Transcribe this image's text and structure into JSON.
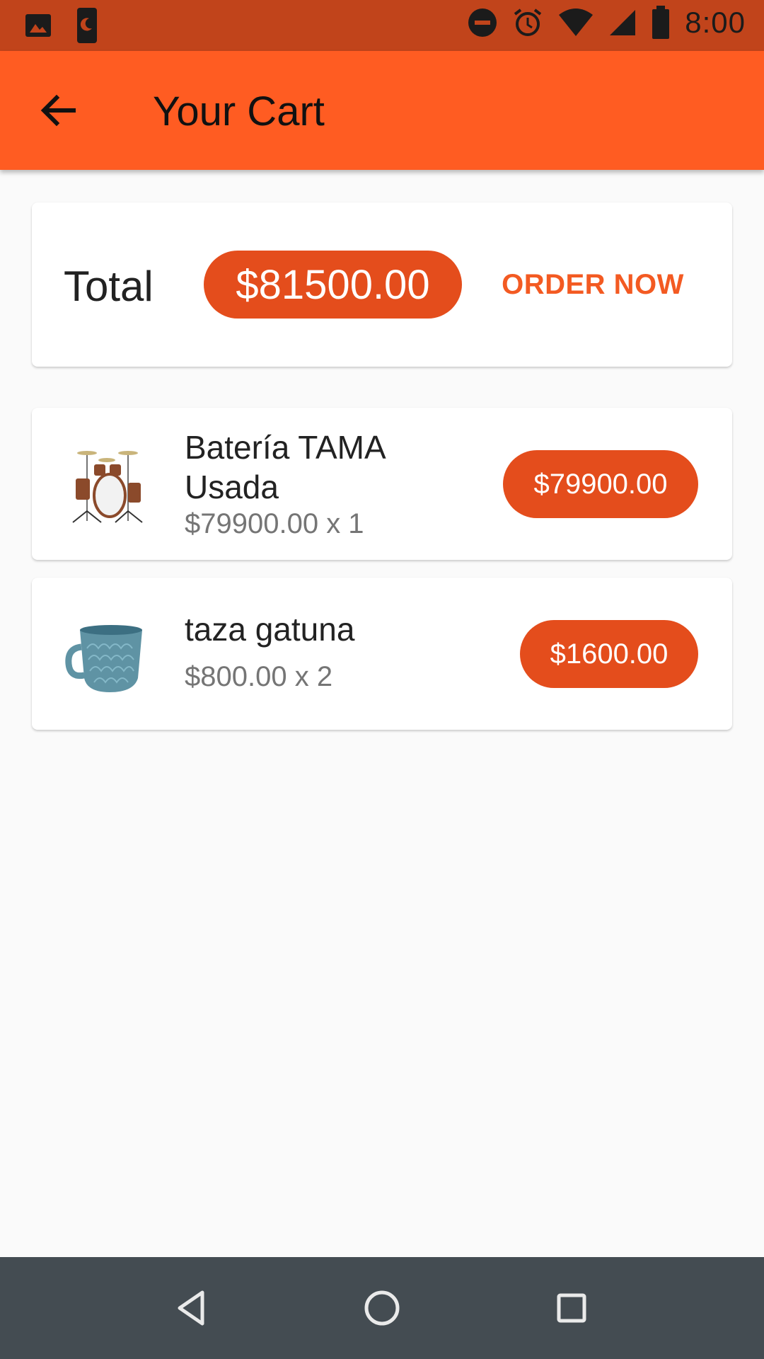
{
  "status_bar": {
    "time": "8:00",
    "icons": [
      "image-icon",
      "phone-night-icon",
      "do-not-disturb-icon",
      "alarm-icon",
      "wifi-icon",
      "cell-signal-icon",
      "battery-icon"
    ]
  },
  "app_bar": {
    "title": "Your Cart",
    "back_icon": "arrow-back-icon"
  },
  "summary": {
    "total_label": "Total",
    "total_amount": "$81500.00",
    "order_button_label": "ORDER NOW"
  },
  "cart_items": [
    {
      "name": "Batería TAMA Usada",
      "quantity_line": "$79900.00 x 1",
      "line_total": "$79900.00",
      "thumbnail": "drum-kit-image"
    },
    {
      "name": "taza gatuna",
      "quantity_line": "$800.00 x 2",
      "line_total": "$1600.00",
      "thumbnail": "blue-mug-image"
    }
  ],
  "nav_bar": {
    "buttons": [
      "nav-back-icon",
      "nav-home-icon",
      "nav-recents-icon"
    ]
  },
  "colors": {
    "status_bar": "#c1441b",
    "app_bar": "#ff5c22",
    "chip": "#e44d1c",
    "accent_text": "#f35a22",
    "nav_bar": "#444c52",
    "background": "#fafafa"
  }
}
